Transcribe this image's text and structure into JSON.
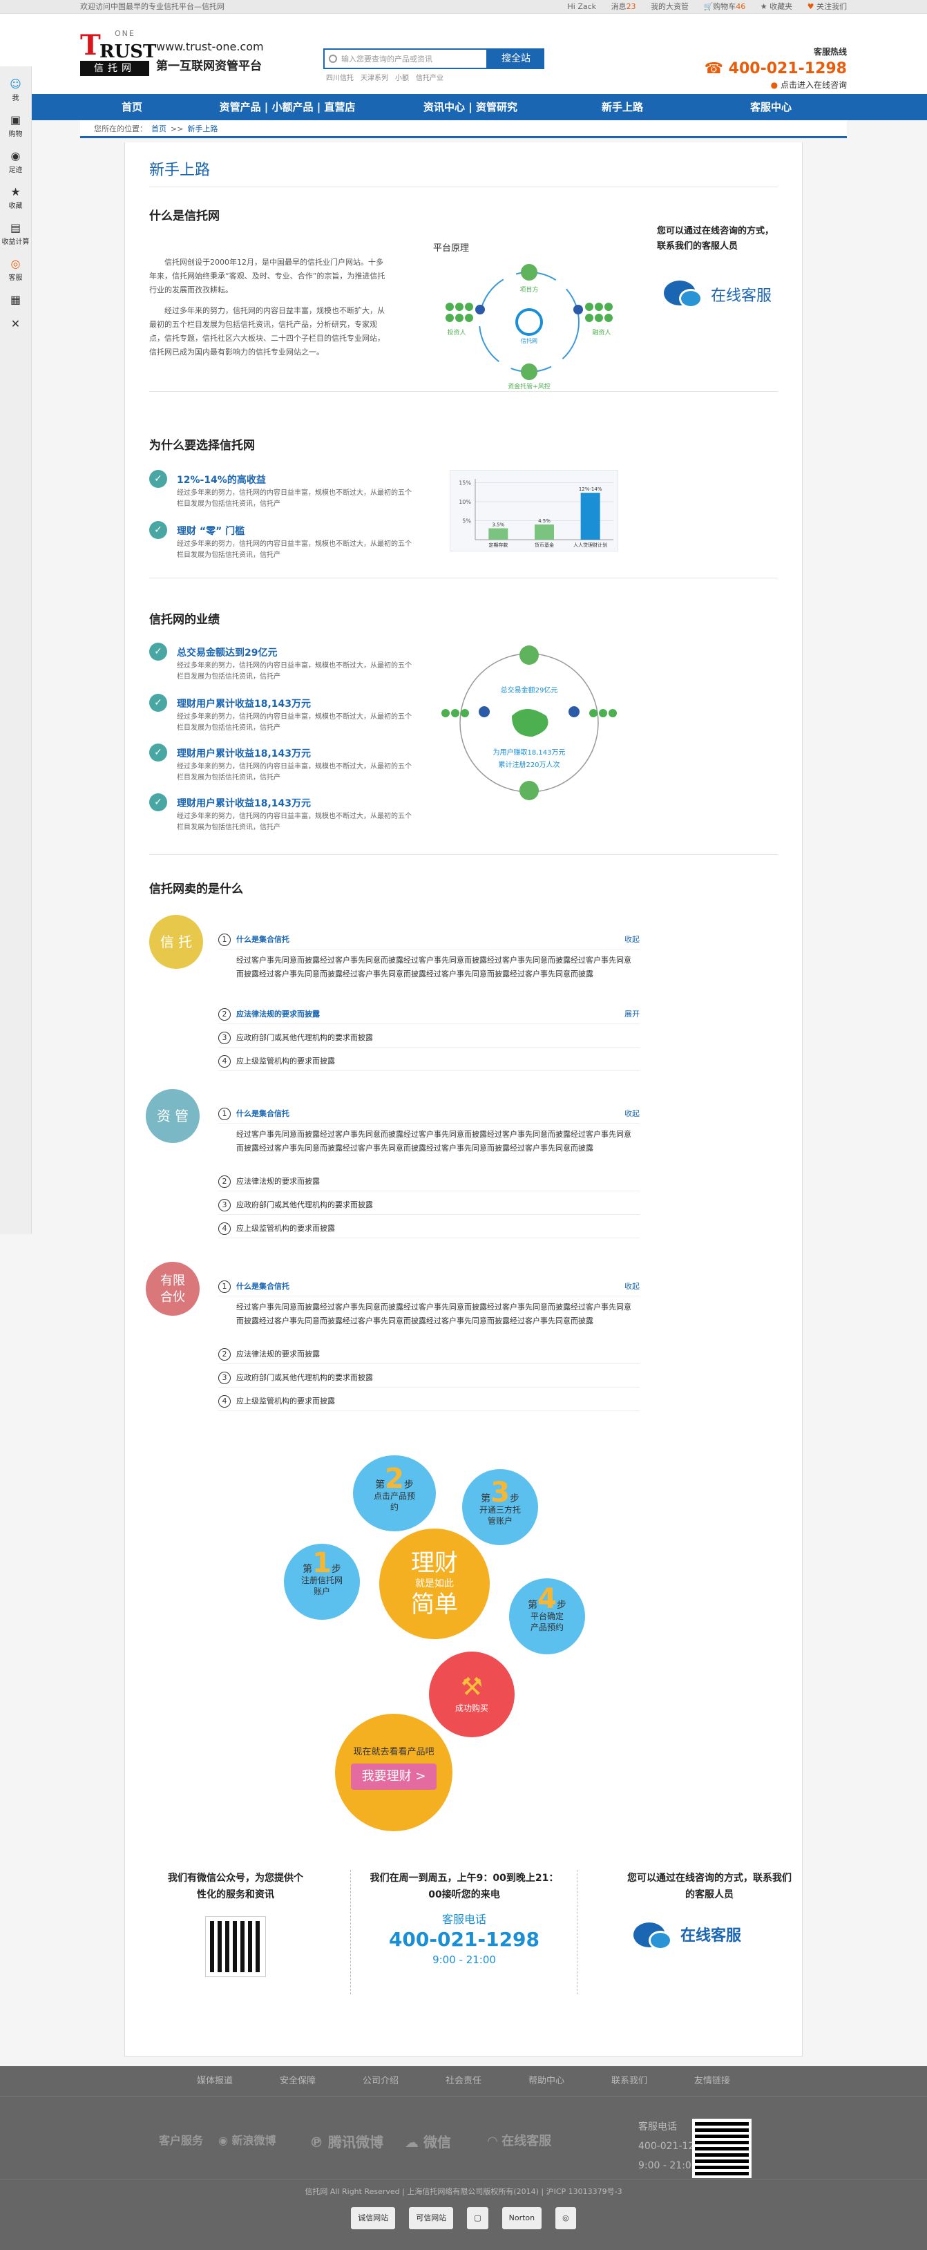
{
  "topbar": {
    "welcome": "欢迎访问中国最早的专业信托平台—信托网",
    "greet": "Hi  Zack",
    "msg_label": "消息",
    "msg_count": "23",
    "account": "我的大资管",
    "cart_label": "购物车",
    "cart_count": "46",
    "fav": "收藏夹",
    "follow": "关注我们"
  },
  "header": {
    "logo_one": "ONE",
    "logo_t": "T",
    "logo_rust": "RUST",
    "logo_cn": "信托网",
    "url": "www.trust-one.com",
    "slogan": "第一互联网资管平台",
    "search_placeholder": "输入您要查询的产品或资讯",
    "search_btn": "搜全站",
    "hot": [
      "四川信托",
      "天津系列",
      "小额",
      "信托产业"
    ],
    "service_label": "客服热线",
    "phone": "400-021-1298",
    "online": "点击进入在线咨询"
  },
  "nav": [
    "首页",
    "资管产品 | 小额产品 | 直营店",
    "资讯中心 | 资管研究",
    "新手上路",
    "客服中心"
  ],
  "crumb": {
    "label": "您所在的位置：",
    "home": "首页",
    "sep": ">>",
    "current": "新手上路"
  },
  "sidebar": [
    {
      "icon": "☺",
      "label": "我"
    },
    {
      "icon": "▣",
      "label": "购物"
    },
    {
      "icon": "◉",
      "label": "足迹"
    },
    {
      "icon": "★",
      "label": "收藏"
    },
    {
      "icon": "▤",
      "label": "收益计算"
    },
    {
      "icon": "◎",
      "label": "客服"
    },
    {
      "icon": "▦",
      "label": ""
    },
    {
      "icon": "✕",
      "label": ""
    }
  ],
  "page": {
    "title": "新手上路"
  },
  "what": {
    "title": "什么是信托网",
    "p1": "信托网创设于2000年12月，是中国最早的信托业门户网站。十多年来，信托网始终秉承“客观、及时、专业、合作”的宗旨，为推进信托行业的发展而孜孜耕耘。",
    "p2": "经过多年来的努力，信托网的内容日益丰富，规模也不断扩大，从最初的五个栏目发展为包括信托资讯，信托产品，分析研究，专家观点，信托专题，信托社区六大板块、二十四个子栏目的信托专业网站，信托网已成为国内最有影响力的信托专业网站之一。",
    "diagram_title": "平台原理",
    "diag_labels": [
      "项目方",
      "投资人",
      "融资人",
      "信托网",
      "资金托管+风控"
    ],
    "contact": "您可以通过在线咨询的方式，联系我们的客服人员",
    "chat": "在线客服"
  },
  "why": {
    "title": "为什么要选择信托网",
    "items": [
      {
        "t": "12%-14%的高收益",
        "d": "经过多年来的努力，信托网的内容日益丰富，规模也不断过大，从最初的五个栏目发展为包括信托资讯，信托产"
      },
      {
        "t": "理财 “零” 门槛",
        "d": "经过多年来的努力，信托网的内容日益丰富，规模也不断过大，从最初的五个栏目发展为包括信托资讯，信托产"
      }
    ]
  },
  "chart_data": {
    "type": "bar",
    "title": "",
    "categories": [
      "定期存款",
      "货币基金",
      "人人贷理财计划"
    ],
    "values": [
      3,
      4,
      12.34
    ],
    "data_labels": [
      "3.5%",
      "4.5%",
      "12%-14%"
    ],
    "ylabels": [
      "15%",
      "10%",
      "5%"
    ],
    "ylim": [
      0,
      16
    ],
    "colors": [
      "#7bc47f",
      "#7bc47f",
      "#1a8fd6"
    ]
  },
  "perf": {
    "title": "信托网的业绩",
    "items": [
      {
        "t": "总交易金额达到29亿元",
        "d": "经过多年来的努力，信托网的内容日益丰富，规模也不断过大，从最初的五个栏目发展为包括信托资讯，信托产"
      },
      {
        "t": "理财用户累计收益18,143万元",
        "d": "经过多年来的努力，信托网的内容日益丰富，规模也不断过大，从最初的五个栏目发展为包括信托资讯，信托产"
      },
      {
        "t": "理财用户累计收益18,143万元",
        "d": "经过多年来的努力，信托网的内容日益丰富，规模也不断过大，从最初的五个栏目发展为包括信托资讯，信托产"
      },
      {
        "t": "理财用户累计收益18,143万元",
        "d": "经过多年来的努力，信托网的内容日益丰富，规模也不断过大，从最初的五个栏目发展为包括信托资讯，信托产"
      }
    ],
    "diag1": "总交易金额29亿元",
    "diag2": "为用户赚取18,143万元",
    "diag3": "累计注册220万人次"
  },
  "sell": {
    "title": "信托网卖的是什么",
    "groups": [
      {
        "name": "信 托",
        "items": [
          "什么是集合信托",
          "应法律法规的要求而披露",
          "应政府部门或其他代理机构的要求而披露",
          "应上级监管机构的要求而披露"
        ],
        "open": "收起",
        "expand": "展开",
        "body": "经过客户事先同意而披露经过客户事先同意而披露经过客户事先同意而披露经过客户事先同意而披露经过客户事先同意而披露经过客户事先同意而披露经过客户事先同意而披露经过客户事先同意而披露经过客户事先同意而披露"
      },
      {
        "name": "资 管",
        "items": [
          "什么是集合信托",
          "应法律法规的要求而披露",
          "应政府部门或其他代理机构的要求而披露",
          "应上级监管机构的要求而披露"
        ],
        "open": "收起",
        "body": "经过客户事先同意而披露经过客户事先同意而披露经过客户事先同意而披露经过客户事先同意而披露经过客户事先同意而披露经过客户事先同意而披露经过客户事先同意而披露经过客户事先同意而披露经过客户事先同意而披露"
      },
      {
        "name": "有限合伙",
        "items": [
          "什么是集合信托",
          "应法律法规的要求而披露",
          "应政府部门或其他代理机构的要求而披露",
          "应上级监管机构的要求而披露"
        ],
        "open": "收起",
        "body": "经过客户事先同意而披露经过客户事先同意而披露经过客户事先同意而披露经过客户事先同意而披露经过客户事先同意而披露经过客户事先同意而披露经过客户事先同意而披露经过客户事先同意而披露经过客户事先同意而披露"
      }
    ]
  },
  "steps": {
    "center1": "理财",
    "center2": "就是如此",
    "center3": "简单",
    "s1": {
      "pre": "第",
      "n": "1",
      "post": "步",
      "t": "注册信托网账户"
    },
    "s2": {
      "pre": "第",
      "n": "2",
      "post": "步",
      "t": "点击产品预约"
    },
    "s3": {
      "pre": "第",
      "n": "3",
      "post": "步",
      "t": "开通三方托管账户"
    },
    "s4": {
      "pre": "第",
      "n": "4",
      "post": "步",
      "t": "平台确定产品预约"
    },
    "done": "成功购买",
    "cta_text": "现在就去看看产品吧",
    "cta_btn": "我要理财 >"
  },
  "ftop": {
    "wechat": "我们有微信公众号，为您提供个性化的服务和资讯",
    "hours": "我们在周一到周五，上午9：00到晚上21：00接听您的来电",
    "svc_label": "客服电话",
    "phone": "400-021-1298",
    "time": "9:00 - 21:00",
    "contact": "您可以通过在线咨询的方式，联系我们的客服人员",
    "chat": "在线客服"
  },
  "footer": {
    "links": [
      "媒体报道",
      "安全保障",
      "公司介绍",
      "社会责任",
      "帮助中心",
      "联系我们",
      "友情链接"
    ],
    "brands": [
      "客户服务",
      "新浪微博",
      "腾讯微博",
      "微信",
      "在线客服"
    ],
    "svc": "客服电话",
    "phone": "400-021-1298",
    "time": "9:00 - 21:00",
    "copy": "信托网 All Right Reserved  |  上海信托网络有限公司版权所有(2014)  |  沪ICP 13013379号-3",
    "badges": [
      "诚信网站",
      "可信网站",
      "▢",
      "Norton",
      "◎"
    ]
  }
}
